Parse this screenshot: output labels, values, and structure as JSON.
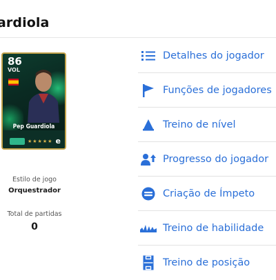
{
  "header": {
    "title": "ardiola"
  },
  "card": {
    "rating": "86",
    "position": "VOL",
    "player_name": "Pep Guardiola",
    "stars": "★★★★★",
    "brand_mark": "e"
  },
  "info": {
    "playstyle_label": "Estilo de jogo",
    "playstyle_value": "Orquestrador",
    "matches_label": "Total de partidas",
    "matches_value": "0"
  },
  "menu": {
    "items": [
      {
        "label": "Detalhes do jogador",
        "icon": "list-icon"
      },
      {
        "label": "Funções de jogadores",
        "icon": "flag-icon"
      },
      {
        "label": "Treino de nível",
        "icon": "triangle-icon"
      },
      {
        "label": "Progresso do jogador",
        "icon": "person-up-icon"
      },
      {
        "label": "Criação de Ímpeto",
        "icon": "momentum-icon"
      },
      {
        "label": "Treino de habilidade",
        "icon": "skill-wave-icon"
      },
      {
        "label": "Treino de posição",
        "icon": "pitch-icon"
      }
    ],
    "accent": "#2a6fd8"
  }
}
